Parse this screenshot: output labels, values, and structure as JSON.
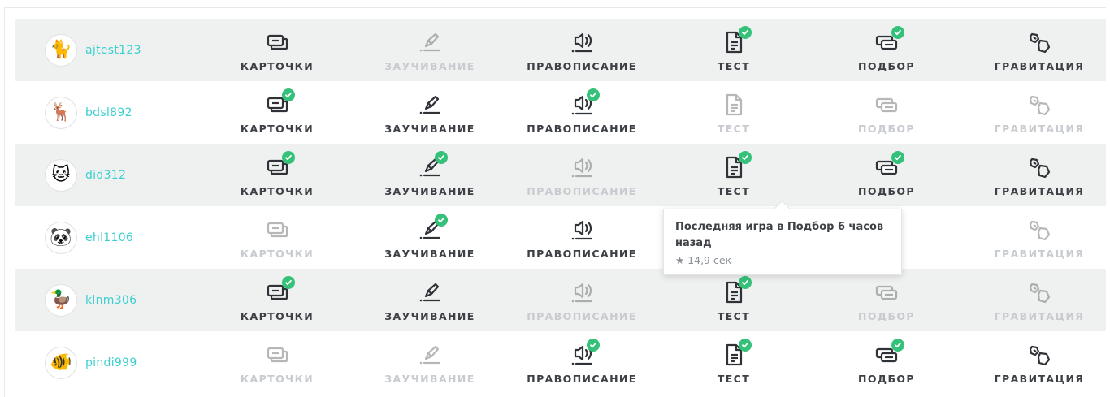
{
  "modes": [
    {
      "key": "cards",
      "label": "КАРТОЧКИ",
      "icon": "cards-icon"
    },
    {
      "key": "learn",
      "label": "ЗАУЧИВАНИЕ",
      "icon": "learn-pen-icon"
    },
    {
      "key": "spell",
      "label": "ПРАВОПИСАНИЕ",
      "icon": "speaker-icon"
    },
    {
      "key": "test",
      "label": "ТЕСТ",
      "icon": "test-document-icon"
    },
    {
      "key": "match",
      "label": "ПОДБОР",
      "icon": "match-cards-icon"
    },
    {
      "key": "gravity",
      "label": "ГРАВИТАЦИЯ",
      "icon": "gravity-asteroids-icon"
    }
  ],
  "students": [
    {
      "username": "ajtest123",
      "avatar": "🐈",
      "states": [
        "active",
        "inactive",
        "active",
        "done",
        "done",
        "active"
      ]
    },
    {
      "username": "bdsl892",
      "avatar": "🦌",
      "states": [
        "done",
        "active",
        "done",
        "inactive",
        "inactive",
        "inactive"
      ]
    },
    {
      "username": "did312",
      "avatar": "🐱",
      "states": [
        "done",
        "done",
        "inactive",
        "done",
        "done",
        "active"
      ]
    },
    {
      "username": "ehl1106",
      "avatar": "🐼",
      "states": [
        "inactive",
        "done",
        "active",
        "hidden",
        "hidden",
        "inactive"
      ]
    },
    {
      "username": "klnm306",
      "avatar": "🦆",
      "states": [
        "done",
        "active",
        "inactive",
        "done",
        "inactive",
        "inactive"
      ]
    },
    {
      "username": "pindi999",
      "avatar": "🐠",
      "states": [
        "inactive",
        "inactive",
        "done",
        "done",
        "done",
        "active"
      ]
    }
  ],
  "tooltip": {
    "title": "Последняя игра в Подбор 6 часов назад",
    "score": "★ 14,9 сек"
  },
  "colors": {
    "accent_username": "#3ccfcf",
    "check_green": "#36c17a",
    "row_shade": "#eff0f0",
    "label_active": "#3d4146",
    "label_inactive": "#c8cbcf"
  }
}
